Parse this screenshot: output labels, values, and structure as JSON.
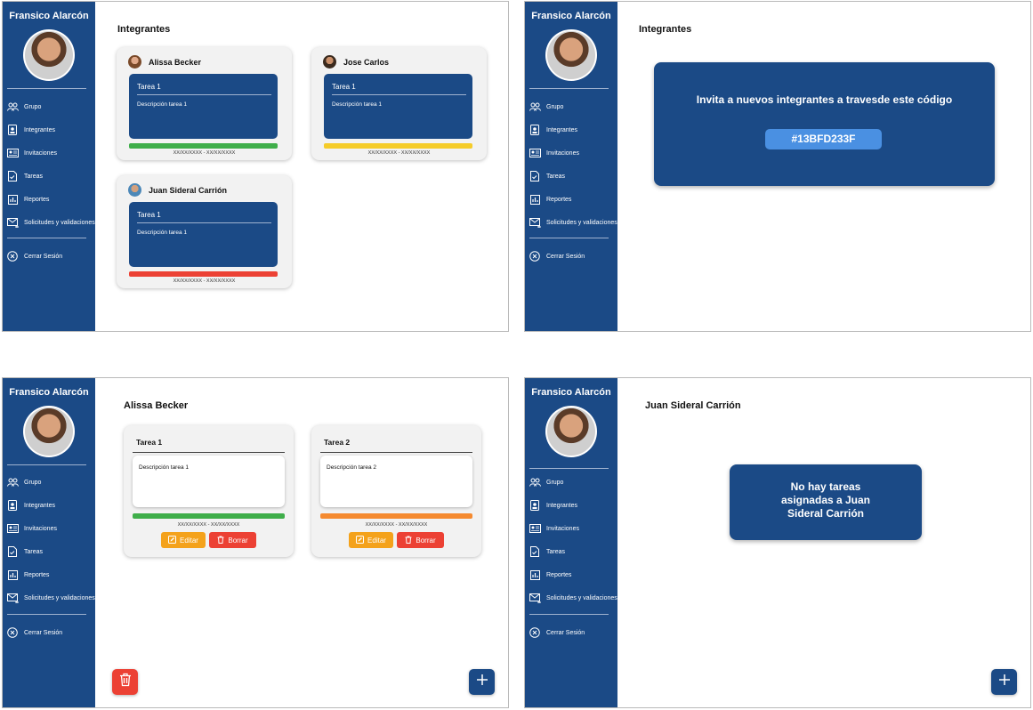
{
  "user": {
    "name": "Fransico Alarcón"
  },
  "nav": [
    {
      "label": "Grupo",
      "icon": "group-icon"
    },
    {
      "label": "Integrantes",
      "icon": "member-icon"
    },
    {
      "label": "Invitaciones",
      "icon": "invitation-icon"
    },
    {
      "label": "Tareas",
      "icon": "tasks-icon"
    },
    {
      "label": "Reportes",
      "icon": "reports-icon"
    },
    {
      "label": "Solicitudes y validaciones",
      "icon": "requests-icon"
    }
  ],
  "logout": {
    "label": "Cerrar Sesión",
    "icon": "close-circle-icon"
  },
  "screen1": {
    "title": "Integrantes",
    "members": [
      {
        "name": "Alissa Becker",
        "task_title": "Tarea 1",
        "task_desc": "Descripción tarea 1",
        "date": "XX/XX/XXXX - XX/XX/XXXX",
        "status_color": "#3fae4a"
      },
      {
        "name": "Jose Carlos",
        "task_title": "Tarea 1",
        "task_desc": "Descripción tarea 1",
        "date": "XX/XX/XXXX - XX/XX/XXXX",
        "status_color": "#f5cc2a"
      },
      {
        "name": "Juan Sideral Carrión",
        "task_title": "Tarea 1",
        "task_desc": "Descripción tarea 1",
        "date": "XX/XX/XXXX - XX/XX/XXXX",
        "status_color": "#ec4134"
      }
    ]
  },
  "screen2": {
    "title": "Integrantes",
    "invite_text": "Invita a nuevos integrantes a travesde este código",
    "code": "#13BFD233F"
  },
  "screen3": {
    "title": "Alissa Becker",
    "tasks": [
      {
        "title": "Tarea 1",
        "desc": "Descripción tarea 1",
        "date": "XX/XX/XXXX - XX/XX/XXXX",
        "status_color": "#3fae4a"
      },
      {
        "title": "Tarea 2",
        "desc": "Descripción tarea 2",
        "date": "XX/XX/XXXX - XX/XX/XXXX",
        "status_color": "#f58a30"
      }
    ],
    "edit_label": "Editar",
    "delete_label": "Borrar"
  },
  "screen4": {
    "title": "Juan Sideral Carrión",
    "empty_lines": [
      "No hay tareas",
      "asignadas a Juan",
      "Sideral Carrión"
    ]
  },
  "colors": {
    "primary": "#1b4a86",
    "accent": "#4a90e2",
    "edit": "#f4a21b",
    "delete": "#ec4134"
  }
}
